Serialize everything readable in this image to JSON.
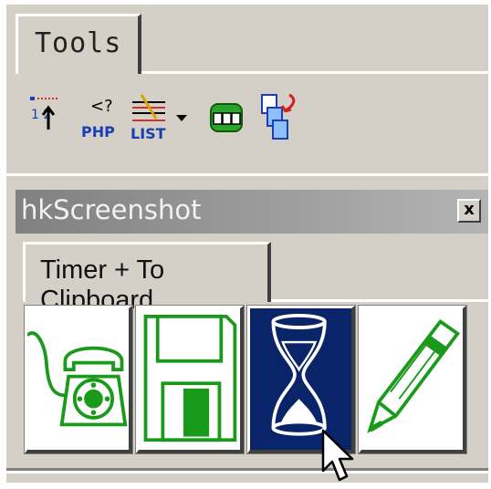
{
  "tools_tab": {
    "label": "Tools"
  },
  "toolbar": {
    "buttons": [
      {
        "name": "line-numbers-icon",
        "label": "1 2"
      },
      {
        "name": "php-icon",
        "label": "PHP"
      },
      {
        "name": "list-icon",
        "label": "LIST"
      },
      {
        "name": "dropdown-arrow-icon"
      },
      {
        "name": "binoculars-icon"
      },
      {
        "name": "copy-pages-icon"
      }
    ]
  },
  "panel": {
    "title": "hkScreenshot",
    "close_label": "x",
    "tab_label": "Timer + To Clipboard",
    "buttons": [
      {
        "name": "phone-icon"
      },
      {
        "name": "floppy-disk-icon"
      },
      {
        "name": "hourglass-icon",
        "active": true
      },
      {
        "name": "pencil-icon"
      }
    ]
  },
  "colors": {
    "window_bg": "#d4d0c8",
    "title_gradient_start": "#808080",
    "title_gradient_end": "#b4b4b4",
    "icon_green": "#1a9a1a",
    "selected_bg": "#0a246a"
  }
}
